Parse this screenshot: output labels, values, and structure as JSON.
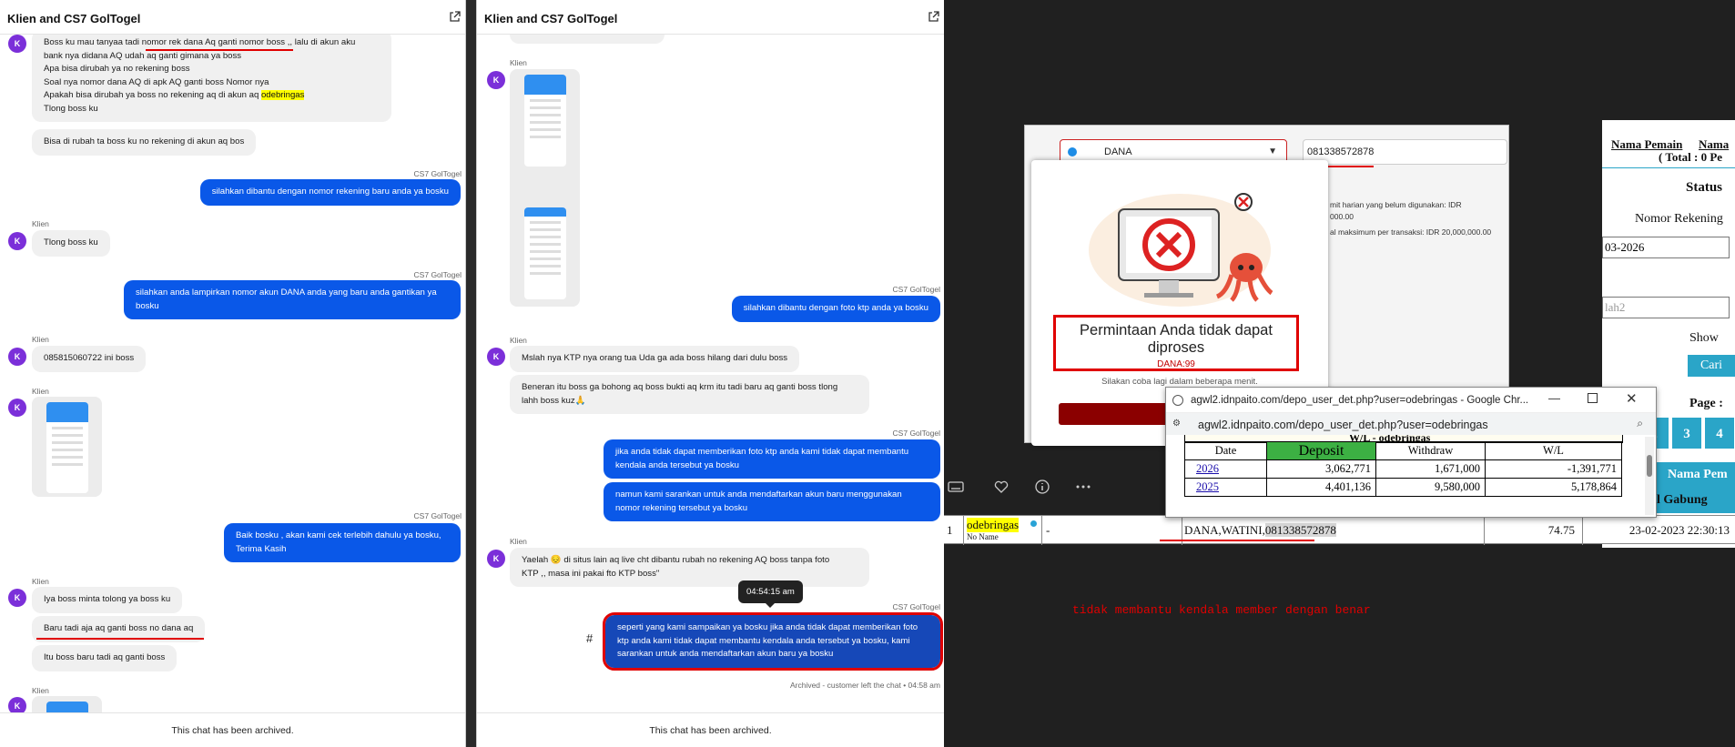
{
  "panel1": {
    "title": "Klien and CS7 GolTogel",
    "footer": "This chat has been archived.",
    "avatar_letter": "K",
    "sender_client": "Klien",
    "sender_cs": "CS7 GolTogel",
    "m1_l1a": "Boss ku mau tanyaa tadi ",
    "m1_l1b": "nomor rek dana Aq ganti nomor boss",
    "m1_l1c": " ,, lalu di akun aku",
    "m1_l2": "bank nya didana AQ udah aq ganti gimana ya boss",
    "m1_l3": "Apa bisa dirubah ya no rekening boss",
    "m1_l4": "Soal nya nomor dana AQ di apk AQ ganti boss Nomor nya",
    "m1_l5a": "Apakah bisa dirubah ya boss no rekening aq di akun aq ",
    "m1_l5b": "odebringas",
    "m1_l6": "Tlong boss ku",
    "m2": "Bisa di rubah ta boss ku no rekening di akun aq bos",
    "m3": "silahkan dibantu dengan nomor rekening baru anda ya bosku",
    "m4": "Tlong boss ku",
    "m5_l1": "silahkan anda lampirkan nomor akun DANA anda yang baru anda gantikan ya",
    "m5_l2": "bosku",
    "m6": "085815060722 ini boss",
    "m7_l1": "Baik bosku , akan kami cek terlebih dahulu ya bosku,",
    "m7_l2": "Terima Kasih",
    "m8": "Iya boss minta tolong ya boss ku",
    "m9": "Baru tadi aja aq ganti boss no dana aq",
    "m10": "Itu boss baru tadi aq ganti boss"
  },
  "panel2": {
    "title": "Klien and CS7 GolTogel",
    "footer": "This chat has been archived.",
    "avatar_letter": "K",
    "sender_client": "Klien",
    "sender_cs": "CS7 GolTogel",
    "m1": "silahkan dibantu dengan foto ktp anda ya bosku",
    "m2": "Mslah nya KTP nya orang tua Uda ga ada boss hilang dari dulu boss",
    "m3_l1": "Beneran itu boss ga bohong aq boss bukti aq krm itu tadi baru aq ganti boss tlong",
    "m3_l2": "lahh boss kuz🙏",
    "m4_l1": "jika anda tidak dapat memberikan foto ktp anda kami tidak dapat membantu",
    "m4_l2": "kendala anda tersebut ya bosku",
    "m5_l1": "namun kami sarankan untuk anda mendaftarkan akun baru menggunakan",
    "m5_l2": "nomor rekening tersebut ya bosku",
    "m6_l1": "Yaelah 😔 di situs lain aq live cht dibantu rubah no rekening AQ boss tanpa foto",
    "m6_l2": "KTP ,, masa ini pakai fto KTP boss\"",
    "tooltip": "04:54:15 am",
    "hash": "#",
    "m7_l1": "seperti yang kami sampaikan ya bosku jika anda tidak dapat memberikan foto",
    "m7_l2": "ktp anda kami tidak dapat membantu kendala anda tersebut ya bosku, kami",
    "m7_l3": "sarankan untuk anda mendaftarkan akun baru ya bosku",
    "archived_note": "Archived - customer left the chat • 04:58 am"
  },
  "dana": {
    "provider": "DANA",
    "account_number": "081338572878",
    "note1a": "mit harian yang belum digunakan: IDR",
    "note1b": "000.00",
    "note2": "al maksimum per transaksi: IDR 20,000,000.00",
    "error_title_l1": "Permintaan Anda tidak dapat",
    "error_title_l2": "diproses",
    "error_code": "DANA:99",
    "error_hint": "Silakan coba lagi dalam beberapa menit."
  },
  "popup": {
    "window_title": "agwl2.idnpaito.com/depo_user_det.php?user=odebringas - Google Chr...",
    "address": "agwl2.idnpaito.com/depo_user_det.php?user=odebringas",
    "table_title": "W/L - odebringas",
    "headers": [
      "Date",
      "Deposit",
      "Withdraw",
      "W/L"
    ],
    "rows": [
      [
        "2026",
        "3,062,771",
        "1,671,000",
        "-1,391,771"
      ],
      [
        "2025",
        "4,401,136",
        "9,580,000",
        "5,178,864"
      ]
    ]
  },
  "right_page": {
    "col_nama": "Nama Pemain",
    "col_nama2": "Nama",
    "total": "( Total : 0 Pe",
    "status": "Status",
    "nomor_rek": "Nomor Rekening",
    "date_value": "03-2026",
    "input2_value": "lah2",
    "show": "Show",
    "cari": "Cari",
    "page": "Page :",
    "pages": [
      "2",
      "3",
      "4"
    ],
    "nama_pem": "Nama Pem",
    "gabung": "l Gabung"
  },
  "bottom_row": {
    "no": "1",
    "username": "odebringas",
    "no_name": "No Name",
    "dash": "-",
    "bank_prefix": "DANA,WATINI,",
    "bank_number": "081338572878",
    "amount": "74.75",
    "date": "23-02-2023 22:30:13"
  },
  "annotation": "tidak membantu kendala member dengan benar",
  "colors": {
    "outgoing_bubble": "#0a58e8",
    "avatar": "#7b2fd9",
    "highlight_red": "#e00000"
  }
}
